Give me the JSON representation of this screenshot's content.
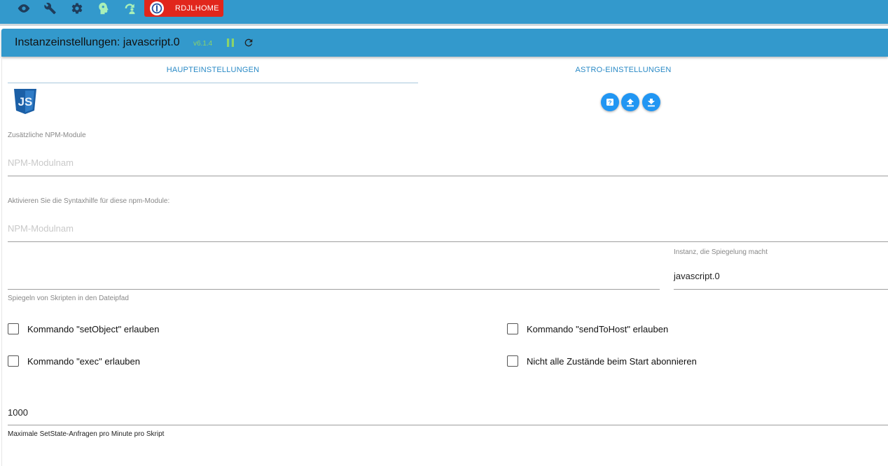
{
  "header": {
    "host_label": "RDJLHOME",
    "icons": [
      "eye-icon",
      "wrench-icon",
      "gear-icon",
      "brain-icon",
      "refresh-person-icon"
    ]
  },
  "instance": {
    "title": "Instanzeinstellungen: javascript.0",
    "version": "v6.1.4"
  },
  "tabs": [
    {
      "label": "HAUPTEINSTELLUNGEN",
      "active": true
    },
    {
      "label": "ASTRO-EINSTELLUNGEN",
      "active": false
    }
  ],
  "fields": {
    "npm_label": "Zusätzliche NPM-Module",
    "npm_placeholder": "NPM-Modulnam",
    "syntax_label": "Aktivieren Sie die Syntaxhilfe für diese npm-Module:",
    "syntax_placeholder": "NPM-Modulnam",
    "mirror_path_helper": "Spiegeln von Skripten in den Dateipfad",
    "mirror_instance_label": "Instanz, die Spiegelung macht",
    "mirror_instance_value": "javascript.0",
    "setstate_value": "1000",
    "setstate_helper": "Maximale SetState-Anfragen pro Minute pro Skript"
  },
  "checkboxes": {
    "set_object": "Kommando \"setObject\" erlauben",
    "send_to_host": "Kommando \"sendToHost\" erlauben",
    "exec": "Kommando \"exec\" erlauben",
    "no_subscribe": "Nicht alle Zustände beim Start abonnieren"
  },
  "colors": {
    "header_blue": "#3399cc",
    "host_red": "#e1261c",
    "accent_blue": "#2196f3",
    "version_green": "#8bd36a"
  }
}
